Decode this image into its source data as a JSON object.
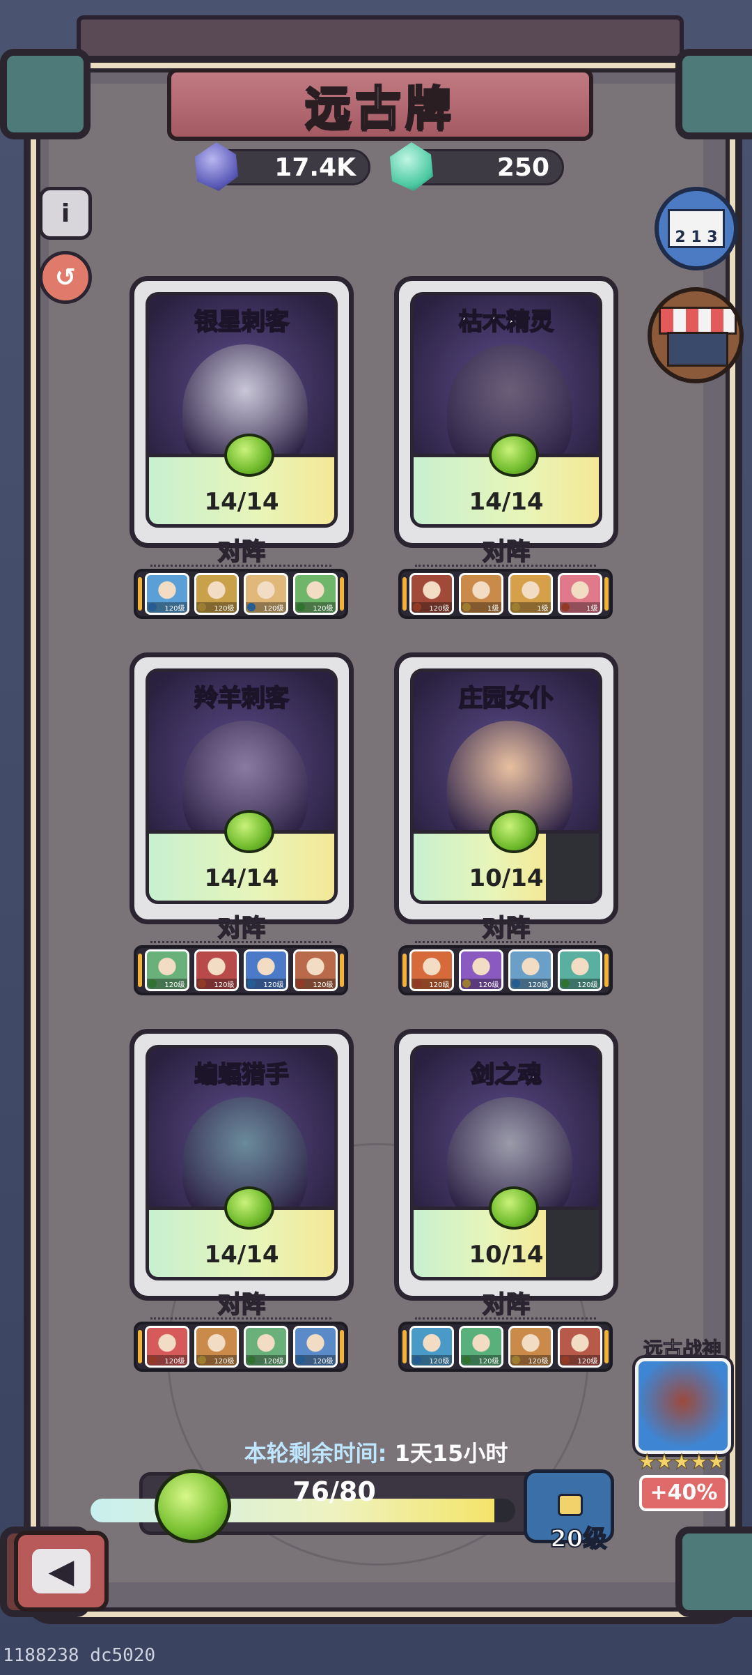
{
  "header": {
    "title": "远古牌",
    "currency_purple": "17.4K",
    "currency_green": "250"
  },
  "side_buttons": {
    "info_icon": "info-icon",
    "history_icon": "refresh-icon",
    "rank_label": "2 1 3",
    "shop_icon": "shop-icon"
  },
  "cards": [
    {
      "name": "银星刺客",
      "progress": "14/14",
      "progress_fraction": 1.0,
      "vs_label": "对阵",
      "art_color": "#c9c6d6",
      "team": [
        {
          "color": "#5aa0d6",
          "lvl": "120级",
          "el": "#3a8fe0"
        },
        {
          "color": "#c9a14a",
          "lvl": "120级",
          "el": "#f2c24a"
        },
        {
          "color": "#e0b87a",
          "lvl": "120级",
          "el": "#3a8fe0"
        },
        {
          "color": "#6fb56a",
          "lvl": "120级",
          "el": "#4ab04a"
        }
      ]
    },
    {
      "name": "枯木精灵",
      "progress": "14/14",
      "progress_fraction": 1.0,
      "vs_label": "对阵",
      "art_color": "#6a5e78",
      "team": [
        {
          "color": "#a14a3a",
          "lvl": "120级",
          "el": "#e05a3a"
        },
        {
          "color": "#c98a4a",
          "lvl": "1级",
          "el": "#f2c24a"
        },
        {
          "color": "#d6a04a",
          "lvl": "1级",
          "el": "#f2c24a"
        },
        {
          "color": "#e07a8a",
          "lvl": "1级",
          "el": "#e05a3a"
        }
      ]
    },
    {
      "name": "羚羊刺客",
      "progress": "14/14",
      "progress_fraction": 1.0,
      "vs_label": "对阵",
      "art_color": "#8a7aa0",
      "team": [
        {
          "color": "#6ab07a",
          "lvl": "120级",
          "el": "#4ab04a"
        },
        {
          "color": "#b84a4a",
          "lvl": "120级",
          "el": "#e05a3a"
        },
        {
          "color": "#4a7ac8",
          "lvl": "120级",
          "el": "#3a8fe0"
        },
        {
          "color": "#b86a4a",
          "lvl": "120级",
          "el": "#e05a3a"
        }
      ]
    },
    {
      "name": "庄园女仆",
      "progress": "10/14",
      "progress_fraction": 0.714,
      "vs_label": "对阵",
      "art_color": "#e8c0a0",
      "team": [
        {
          "color": "#d66a3a",
          "lvl": "120级",
          "el": "#e05a3a"
        },
        {
          "color": "#8a5ac0",
          "lvl": "120级",
          "el": "#f2c24a"
        },
        {
          "color": "#6aa0c8",
          "lvl": "120级",
          "el": "#3a8fe0"
        },
        {
          "color": "#5ab0a0",
          "lvl": "120级",
          "el": "#4ab04a"
        }
      ]
    },
    {
      "name": "蝙蝠猎手",
      "progress": "14/14",
      "progress_fraction": 1.0,
      "vs_label": "对阵",
      "art_color": "#6a8a9a",
      "team": [
        {
          "color": "#d65a5a",
          "lvl": "120级",
          "el": "#e05a3a"
        },
        {
          "color": "#c98a4a",
          "lvl": "120级",
          "el": "#f2c24a"
        },
        {
          "color": "#6ab07a",
          "lvl": "120级",
          "el": "#4ab04a"
        },
        {
          "color": "#5a8ac8",
          "lvl": "120级",
          "el": "#3a8fe0"
        }
      ]
    },
    {
      "name": "剑之魂",
      "progress": "10/14",
      "progress_fraction": 0.714,
      "vs_label": "对阵",
      "art_color": "#9a9aa8",
      "team": [
        {
          "color": "#4a9ac8",
          "lvl": "120级",
          "el": "#3a8fe0"
        },
        {
          "color": "#5ab07a",
          "lvl": "120级",
          "el": "#4ab04a"
        },
        {
          "color": "#c98a4a",
          "lvl": "120级",
          "el": "#f2c24a"
        },
        {
          "color": "#b85a4a",
          "lvl": "120级",
          "el": "#e05a3a"
        }
      ]
    }
  ],
  "footer": {
    "timer_label": "本轮剩余时间:",
    "timer_value": "1天15小时",
    "progress_text": "76/80",
    "progress_fraction": 0.95,
    "chest_level": "20级",
    "back_icon": "back-arrow-icon"
  },
  "bonus_panel": {
    "title": "远古战神",
    "stars": "★★★★★",
    "bonus": "+40%"
  },
  "watermark": "1188238 dc5020"
}
